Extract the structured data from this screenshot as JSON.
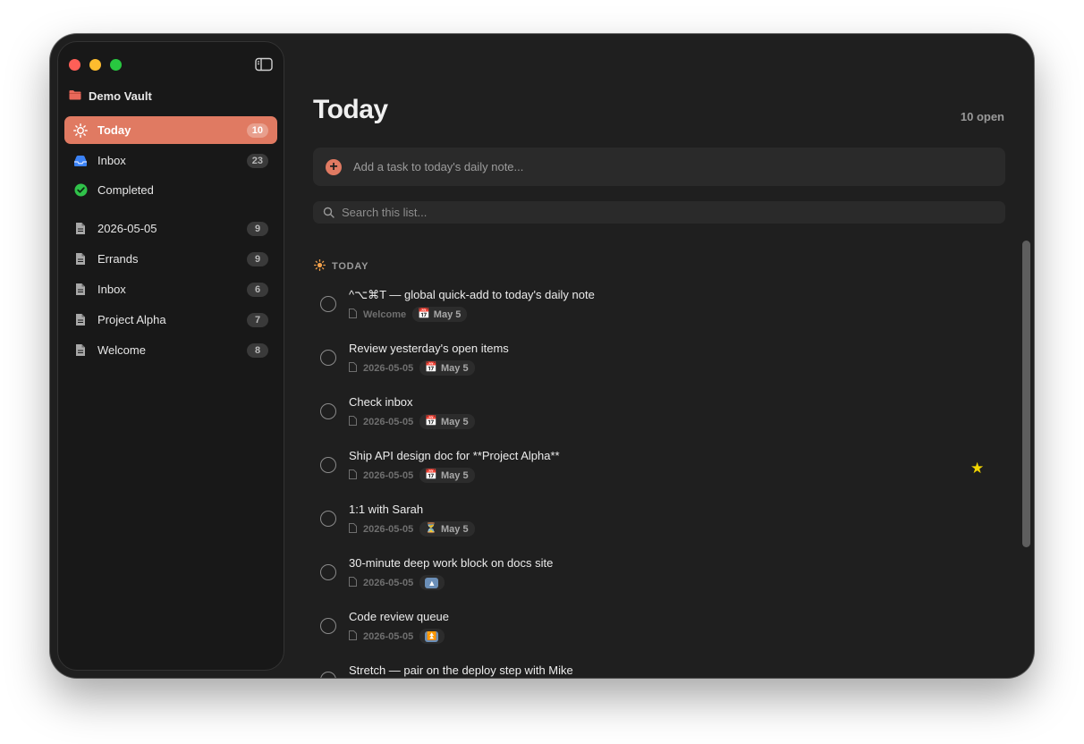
{
  "vault": {
    "name": "Demo Vault"
  },
  "nav": [
    {
      "label": "Today",
      "count": "10",
      "icon": "sun-icon"
    },
    {
      "label": "Inbox",
      "count": "23",
      "icon": "inbox-tray-icon"
    },
    {
      "label": "Completed",
      "count": "",
      "icon": "check-circle-icon"
    }
  ],
  "notes": [
    {
      "label": "2026-05-05",
      "count": "9"
    },
    {
      "label": "Errands",
      "count": "9"
    },
    {
      "label": "Inbox",
      "count": "6"
    },
    {
      "label": "Project Alpha",
      "count": "7"
    },
    {
      "label": "Welcome",
      "count": "8"
    }
  ],
  "main": {
    "title": "Today",
    "open_count": "10 open",
    "add_placeholder": "Add a task to today's daily note...",
    "search_placeholder": "Search this list...",
    "section": "TODAY"
  },
  "tasks": [
    {
      "title": "^⌥⌘T — global quick-add to today's daily note",
      "source": "Welcome",
      "chip": "May 5",
      "chip_icon": "calendar"
    },
    {
      "title": "Review yesterday's open items",
      "source": "2026-05-05",
      "chip": "May 5",
      "chip_icon": "calendar"
    },
    {
      "title": "Check inbox",
      "source": "2026-05-05",
      "chip": "May 5",
      "chip_icon": "calendar"
    },
    {
      "title": "Ship API design doc for **Project Alpha**",
      "source": "2026-05-05",
      "chip": "May 5",
      "chip_icon": "calendar",
      "starred": true
    },
    {
      "title": "1:1 with Sarah",
      "source": "2026-05-05",
      "chip": "May 5",
      "chip_icon": "hourglass"
    },
    {
      "title": "30-minute deep work block on docs site",
      "source": "2026-05-05",
      "chip": "",
      "chip_icon": "priority-up"
    },
    {
      "title": "Code review queue",
      "source": "2026-05-05",
      "chip": "",
      "chip_icon": "priority-double-up"
    },
    {
      "title": "Stretch — pair on the deploy step with Mike",
      "source": "",
      "chip": "",
      "chip_icon": ""
    }
  ],
  "colors": {
    "accent": "#e07a62",
    "star": "#f2d500",
    "background": "#1f1f1f",
    "sidebar": "#181818"
  }
}
